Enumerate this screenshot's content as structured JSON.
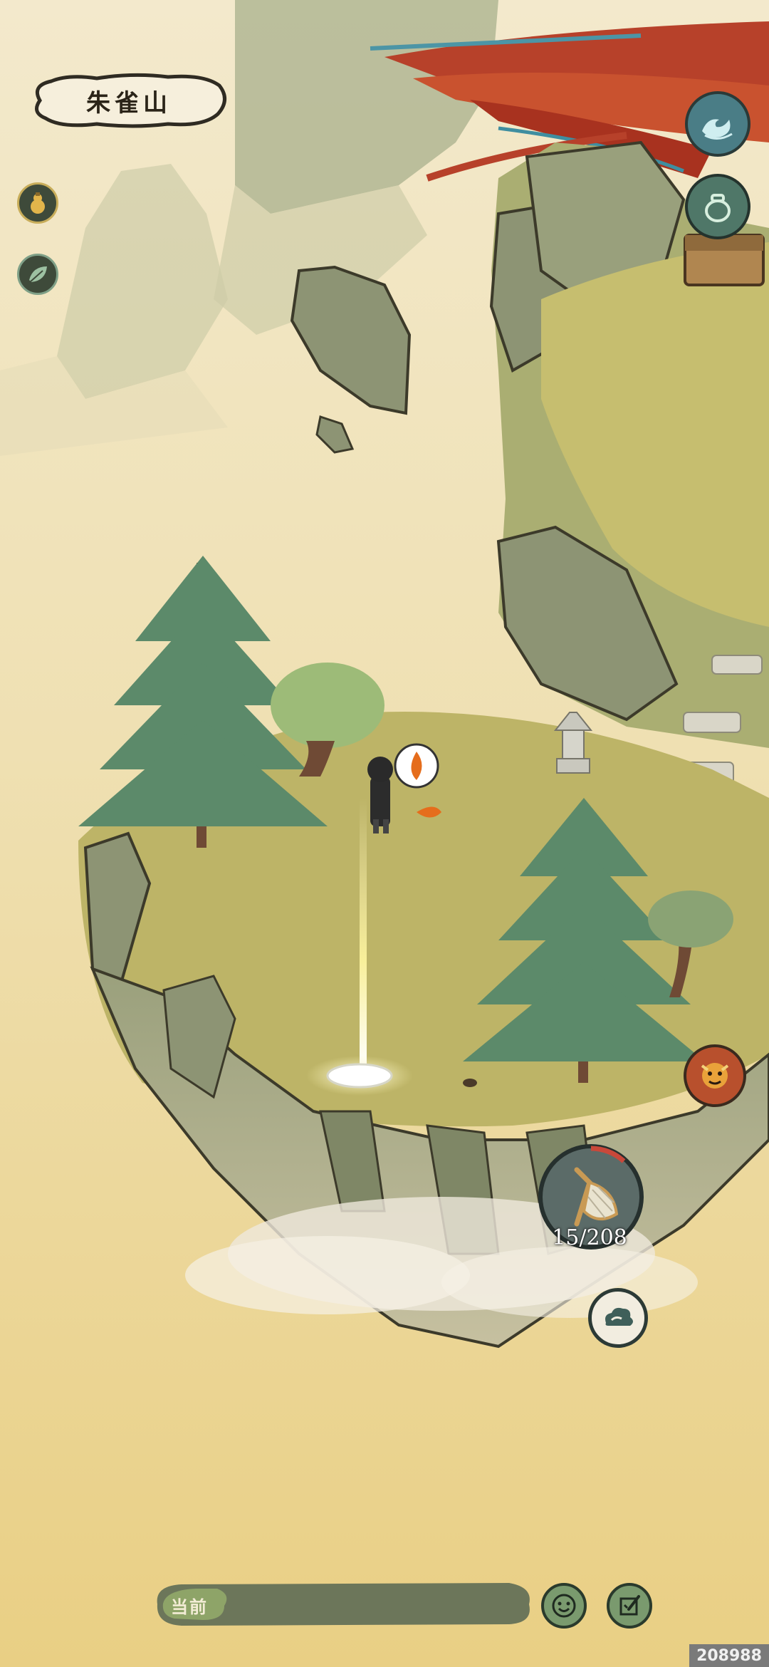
{
  "location": {
    "name": "朱雀山"
  },
  "left_buttons": [
    {
      "icon": "gourd-icon"
    },
    {
      "icon": "leaf-icon"
    }
  ],
  "right_buttons": [
    {
      "icon": "wave-icon"
    },
    {
      "icon": "jar-icon"
    },
    {
      "icon": "beast-mask-icon"
    },
    {
      "icon": "cloud-icon"
    }
  ],
  "net_tool": {
    "icon": "net-icon",
    "counter": "15/208"
  },
  "chat": {
    "label": "当前"
  },
  "bottom_buttons": [
    {
      "icon": "smile-icon"
    },
    {
      "icon": "brush-note-icon"
    }
  ],
  "watermark": "208988",
  "colors": {
    "sky": "#f1e6c6",
    "ground": "#e8cc7c",
    "grass": "#b8b263",
    "rock": "#8e9673",
    "ui_dark": "#3e4a3a",
    "ui_teal": "#5f8f80"
  }
}
